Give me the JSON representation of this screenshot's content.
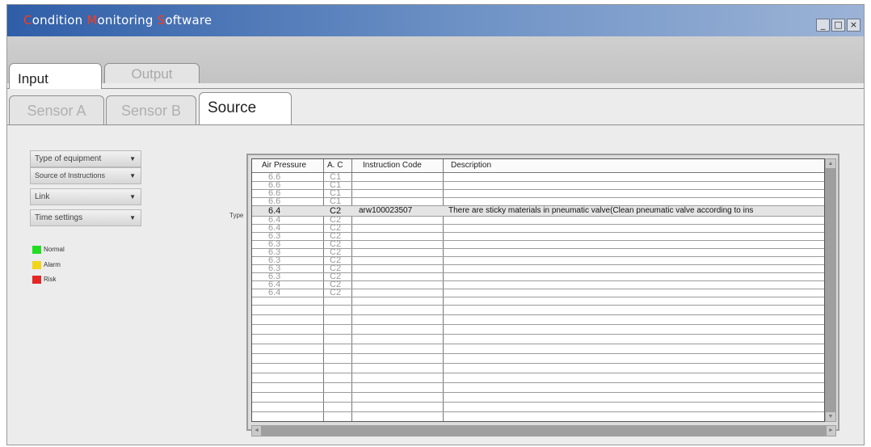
{
  "window": {
    "title_parts": [
      {
        "cap": "C",
        "rest": "ondition "
      },
      {
        "cap": "M",
        "rest": "onitoring "
      },
      {
        "cap": "S",
        "rest": "oftware"
      }
    ],
    "controls": {
      "minimize": "_",
      "maximize": "□",
      "close": "×"
    }
  },
  "main_tabs": [
    {
      "label": "Input",
      "active": true
    },
    {
      "label": "Output",
      "active": false
    }
  ],
  "sub_tabs": [
    {
      "label": "Sensor A",
      "active": false
    },
    {
      "label": "Sensor B",
      "active": false
    },
    {
      "label": "Source",
      "active": true
    }
  ],
  "dropdowns": [
    {
      "label": "Type of equipment",
      "arrow": "▼"
    },
    {
      "label": "Source of Instructions",
      "arrow": "▼"
    },
    {
      "label": "Link",
      "arrow": "▼"
    },
    {
      "label": "Time settings",
      "arrow": "▼"
    }
  ],
  "legend": [
    {
      "label": "Normal",
      "color": "#22dd22"
    },
    {
      "label": "Alarm",
      "color": "#f2d51a"
    },
    {
      "label": "Risk",
      "color": "#e32626"
    }
  ],
  "row_label": "Type",
  "row_marker": "►",
  "grid": {
    "columns": [
      "Air Pressure",
      "A. C",
      "Instruction Code",
      "Description"
    ],
    "rows": [
      {
        "air_pressure": "6.6",
        "ac": "C1",
        "code": "",
        "description": ""
      },
      {
        "air_pressure": "6.6",
        "ac": "C1",
        "code": "",
        "description": ""
      },
      {
        "air_pressure": "6.6",
        "ac": "C1",
        "code": "",
        "description": ""
      },
      {
        "air_pressure": "6.6",
        "ac": "C1",
        "code": "",
        "description": ""
      },
      {
        "air_pressure": "6.4",
        "ac": "C2",
        "code": "arw100023507",
        "description": "There are sticky materials in pneumatic valve(Clean pneumatic valve according to ins",
        "selected": true
      },
      {
        "air_pressure": "6.4",
        "ac": "C2",
        "code": "",
        "description": ""
      },
      {
        "air_pressure": "6.4",
        "ac": "C2",
        "code": "",
        "description": ""
      },
      {
        "air_pressure": "6.3",
        "ac": "C2",
        "code": "",
        "description": ""
      },
      {
        "air_pressure": "6.3",
        "ac": "C2",
        "code": "",
        "description": ""
      },
      {
        "air_pressure": "6.3",
        "ac": "C2",
        "code": "",
        "description": ""
      },
      {
        "air_pressure": "6.3",
        "ac": "C2",
        "code": "",
        "description": ""
      },
      {
        "air_pressure": "6.3",
        "ac": "C2",
        "code": "",
        "description": ""
      },
      {
        "air_pressure": "6.3",
        "ac": "C2",
        "code": "",
        "description": ""
      },
      {
        "air_pressure": "6.4",
        "ac": "C2",
        "code": "",
        "description": ""
      },
      {
        "air_pressure": "6.4",
        "ac": "C2",
        "code": "",
        "description": ""
      }
    ],
    "scroll_arrows": {
      "up": "▲",
      "down": "▼",
      "left": "◄",
      "right": "►"
    }
  }
}
